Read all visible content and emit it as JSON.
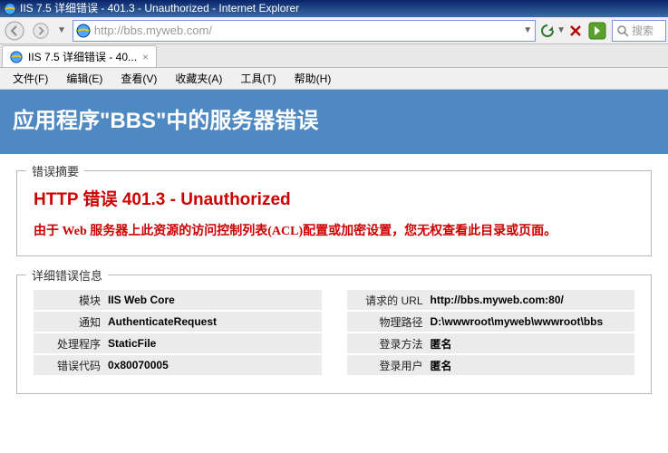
{
  "window": {
    "title": "IIS 7.5 详细错误 - 401.3 - Unauthorized - Internet Explorer"
  },
  "urlbar": {
    "value": "http://bbs.myweb.com/"
  },
  "searchbox": {
    "placeholder": "搜索"
  },
  "tab": {
    "label": "IIS 7.5 详细错误 - 40...",
    "close": "×"
  },
  "menus": {
    "file": "文件(F)",
    "edit": "编辑(E)",
    "view": "查看(V)",
    "favorites": "收藏夹(A)",
    "tools": "工具(T)",
    "help": "帮助(H)"
  },
  "page": {
    "heading": "应用程序\"BBS\"中的服务器错误",
    "summary_legend": "错误摘要",
    "error_title": "HTTP 错误 401.3 - Unauthorized",
    "error_desc": "由于 Web 服务器上此资源的访问控制列表(ACL)配置或加密设置，您无权查看此目录或页面。",
    "detail_legend": "详细错误信息",
    "left": {
      "module_l": "模块",
      "module_v": "IIS Web Core",
      "notify_l": "通知",
      "notify_v": "AuthenticateRequest",
      "handler_l": "处理程序",
      "handler_v": "StaticFile",
      "code_l": "错误代码",
      "code_v": "0x80070005"
    },
    "right": {
      "requrl_l": "请求的 URL",
      "requrl_v": "http://bbs.myweb.com:80/",
      "phys_l": "物理路径",
      "phys_v": "D:\\wwwroot\\myweb\\wwwroot\\bbs",
      "method_l": "登录方法",
      "method_v": "匿名",
      "user_l": "登录用户",
      "user_v": "匿名"
    }
  }
}
